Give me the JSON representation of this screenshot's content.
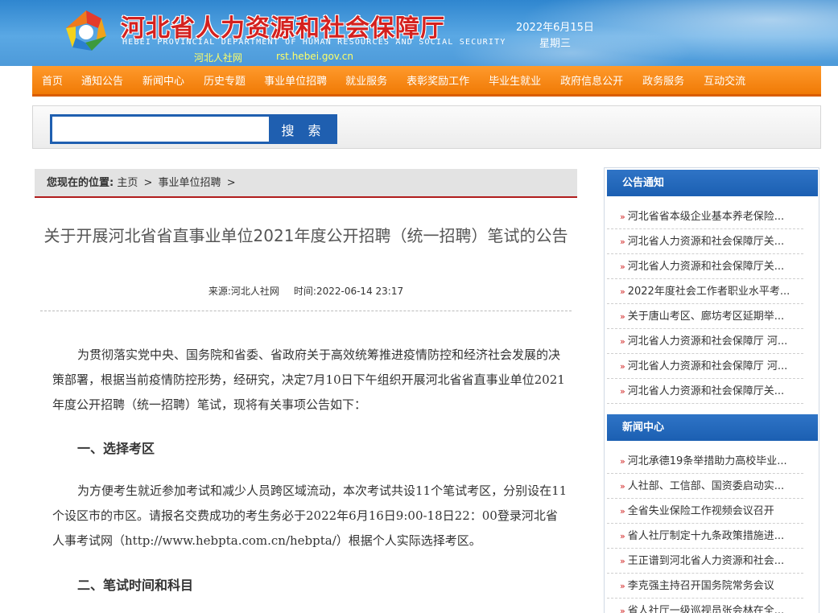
{
  "header": {
    "title": "河北省人力资源和社会保障厅",
    "subtitle": "HEBEI PROVINCIAL DEPARTMENT OF HUMAN RESOURCES AND SOCIAL SECURITY",
    "short_name": "河北人社网",
    "url": "rst.hebei.gov.cn",
    "date": "2022年6月15日",
    "weekday": "星期三"
  },
  "nav": {
    "items": [
      "首页",
      "通知公告",
      "新闻中心",
      "历史专题",
      "事业单位招聘",
      "就业服务",
      "表彰奖励工作",
      "毕业生就业",
      "政府信息公开",
      "政务服务",
      "互动交流"
    ]
  },
  "search": {
    "value": "",
    "button_label": "搜 索"
  },
  "breadcrumb": {
    "label": "您现在的位置:",
    "home": "主页",
    "sep1": ">",
    "current": "事业单位招聘",
    "sep2": ">"
  },
  "article": {
    "title": "关于开展河北省省直事业单位2021年度公开招聘（统一招聘）笔试的公告",
    "source": "来源:河北人社网",
    "time": "时间:2022-06-14 23:17",
    "para1": "为贯彻落实党中央、国务院和省委、省政府关于高效统筹推进疫情防控和经济社会发展的决策部署，根据当前疫情防控形势，经研究，决定7月10日下午组织开展河北省省直事业单位2021年度公开招聘（统一招聘）笔试，现将有关事项公告如下：",
    "heading1": "一、选择考区",
    "para2": "为方便考生就近参加考试和减少人员跨区域流动，本次考试共设11个笔试考区，分别设在11个设区市的市区。请报名交费成功的考生务必于2022年6月16日9:00-18日22：00登录河北省人事考试网（http://www.hebpta.com.cn/hebpta/）根据个人实际选择考区。",
    "heading2": "二、笔试时间和科目"
  },
  "sidebar": {
    "notices": {
      "title": "公告通知",
      "items": [
        "河北省省本级企业基本养老保险...",
        "河北省人力资源和社会保障厅关...",
        "河北省人力资源和社会保障厅关...",
        "2022年度社会工作者职业水平考...",
        "关于唐山考区、廊坊考区延期举...",
        "河北省人力资源和社会保障厅 河...",
        "河北省人力资源和社会保障厅 河...",
        "河北省人力资源和社会保障厅关..."
      ]
    },
    "news": {
      "title": "新闻中心",
      "items": [
        "河北承德19条举措助力高校毕业...",
        "人社部、工信部、国资委启动实...",
        "全省失业保险工作视频会议召开",
        "省人社厅制定十九条政策措施进...",
        "王正谱到河北省人力资源和社会...",
        "李克强主持召开国务院常务会议",
        "省人社厅一级巡视员张会林在全..."
      ]
    },
    "bullet": "»"
  }
}
